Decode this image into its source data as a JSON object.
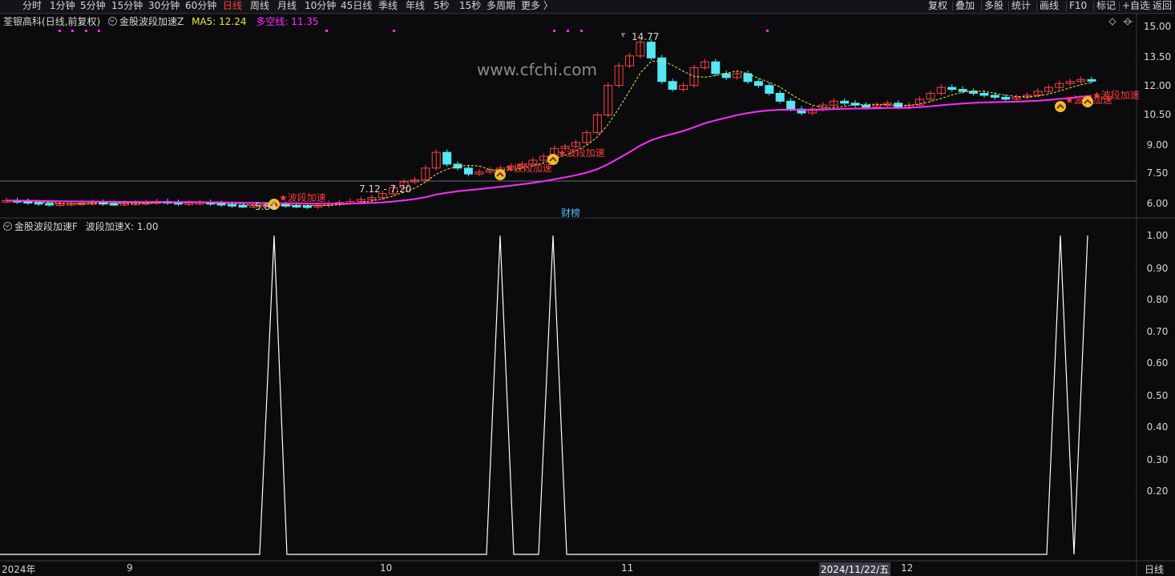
{
  "toolbar": {
    "timeframes": [
      "分时",
      "1分钟",
      "5分钟",
      "15分钟",
      "30分钟",
      "60分钟",
      "日线",
      "周线",
      "月线",
      "10分钟",
      "45日线",
      "季线",
      "年线",
      "5秒",
      "15秒",
      "多周期",
      "更多 〉"
    ],
    "active_timeframe": "日线",
    "right_buttons": [
      "复权",
      "叠加",
      "多股",
      "统计",
      "画线",
      "F10",
      "标记",
      "+自选",
      "返回"
    ]
  },
  "header": {
    "stock_name": "荃银高科",
    "mode": "(日线,前复权)",
    "indicator_name": "金股波段加速Z",
    "ma5_label": "MA5: 12.24",
    "duokong_label": "多空线: 11.35"
  },
  "sub_header": {
    "indicator_name": "金股波段加速F",
    "value_label": "波段加速X: 1.00"
  },
  "watermark": "www.cfchi.com",
  "annotations": {
    "high_label": "14.77",
    "low_label": "5.84",
    "range_label": "7.12 - 7.20",
    "accel_label": "★波段加速",
    "caibang_label": "财榜"
  },
  "price_axis": [
    "15.00",
    "13.50",
    "12.00",
    "10.50",
    "9.00",
    "7.50",
    "6.00"
  ],
  "sub_axis": [
    "1.00",
    "0.90",
    "0.80",
    "0.70",
    "0.60",
    "0.50",
    "0.40",
    "0.30",
    "0.20"
  ],
  "time_axis": {
    "labels": [
      "2024年",
      "9",
      "10",
      "11",
      "12"
    ],
    "cursor_date": "2024/11/22/五",
    "period": "日线"
  },
  "colors": {
    "up": "#ff4040",
    "down": "#54e7f5",
    "ma5": "#e8e84a",
    "duokong": "#ff2bff",
    "accent_red": "#ff3b3b",
    "signal_line": "#ffffff"
  },
  "chart_data": [
    {
      "type": "candlestick",
      "title": "荃银高科 (日线,前复权)",
      "ylim": [
        5.4,
        15.4
      ],
      "x": [
        "2024/08",
        "2024/09",
        "2024/10",
        "2024/11",
        "2024/12"
      ],
      "series": [
        {
          "name": "MA5",
          "latest": 12.24
        },
        {
          "name": "多空线",
          "latest": 11.35
        }
      ],
      "points_of_interest": {
        "high": 14.77,
        "low": 5.84,
        "range": [
          7.12,
          7.2
        ]
      },
      "markers": [
        "★波段加速",
        "★波段加速",
        "★波段加速",
        "★波段加速"
      ]
    },
    {
      "type": "line",
      "title": "金股波段加速F",
      "series": [
        {
          "name": "波段加速X",
          "latest": 1.0
        }
      ],
      "ylim": [
        0,
        1.0
      ],
      "spike_positions": [
        342,
        624,
        690,
        1323,
        1357
      ],
      "spike_values": [
        1.0,
        1.0,
        1.0,
        1.0,
        1.0
      ]
    }
  ]
}
